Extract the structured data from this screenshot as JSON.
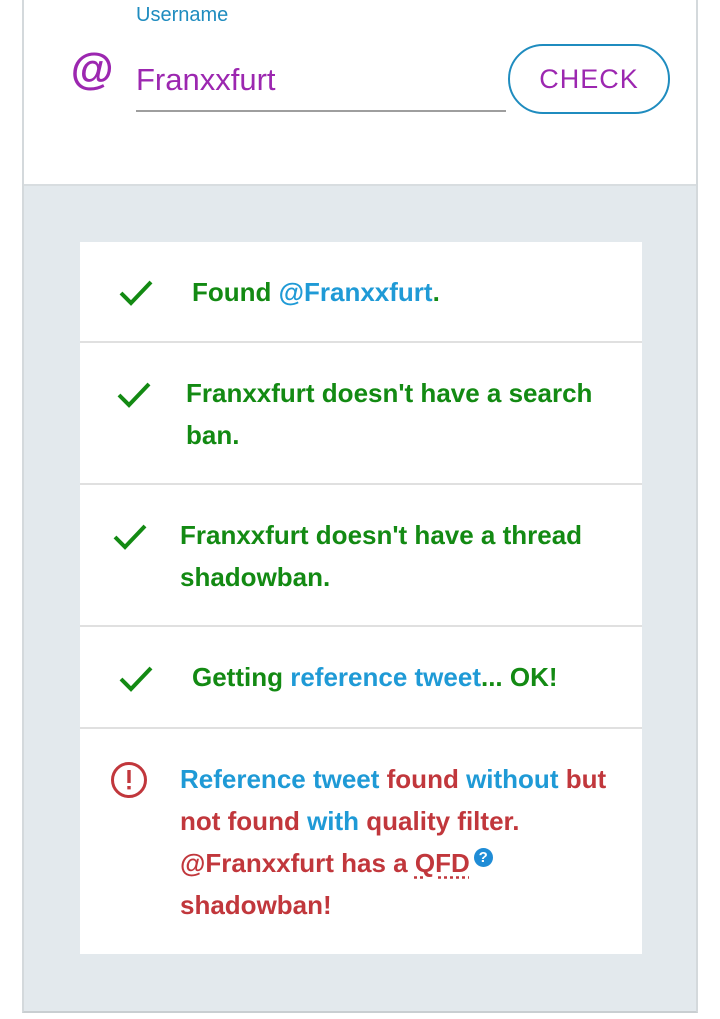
{
  "form": {
    "label": "Username",
    "at_symbol": "@",
    "username_value": "Franxxfurt",
    "check_button": "CHECK"
  },
  "results": [
    {
      "status": "ok",
      "parts": [
        "Found ",
        "@Franxxfurt",
        "."
      ]
    },
    {
      "status": "ok",
      "text": "Franxxfurt doesn't have a search ban."
    },
    {
      "status": "ok",
      "text": "Franxxfurt doesn't have a thread shadowban."
    },
    {
      "status": "ok",
      "parts": [
        "Getting ",
        "reference tweet",
        "... OK!"
      ]
    },
    {
      "status": "error",
      "parts": [
        "Reference tweet",
        " found ",
        "without",
        " but not found ",
        "with",
        " quality filter. @Franxxfurt has a ",
        "QFD",
        " shadowban!"
      ],
      "help_glyph": "?"
    }
  ],
  "colors": {
    "accent_blue": "#1f8cbf",
    "link_blue": "#1f9ad6",
    "purple": "#9c27b0",
    "success_green": "#138a13",
    "error_red": "#c1373c",
    "background": "#e3e9ed"
  },
  "icons": {
    "ok": "check-icon",
    "error": "exclamation-circle-icon",
    "help": "question-circle-icon"
  }
}
